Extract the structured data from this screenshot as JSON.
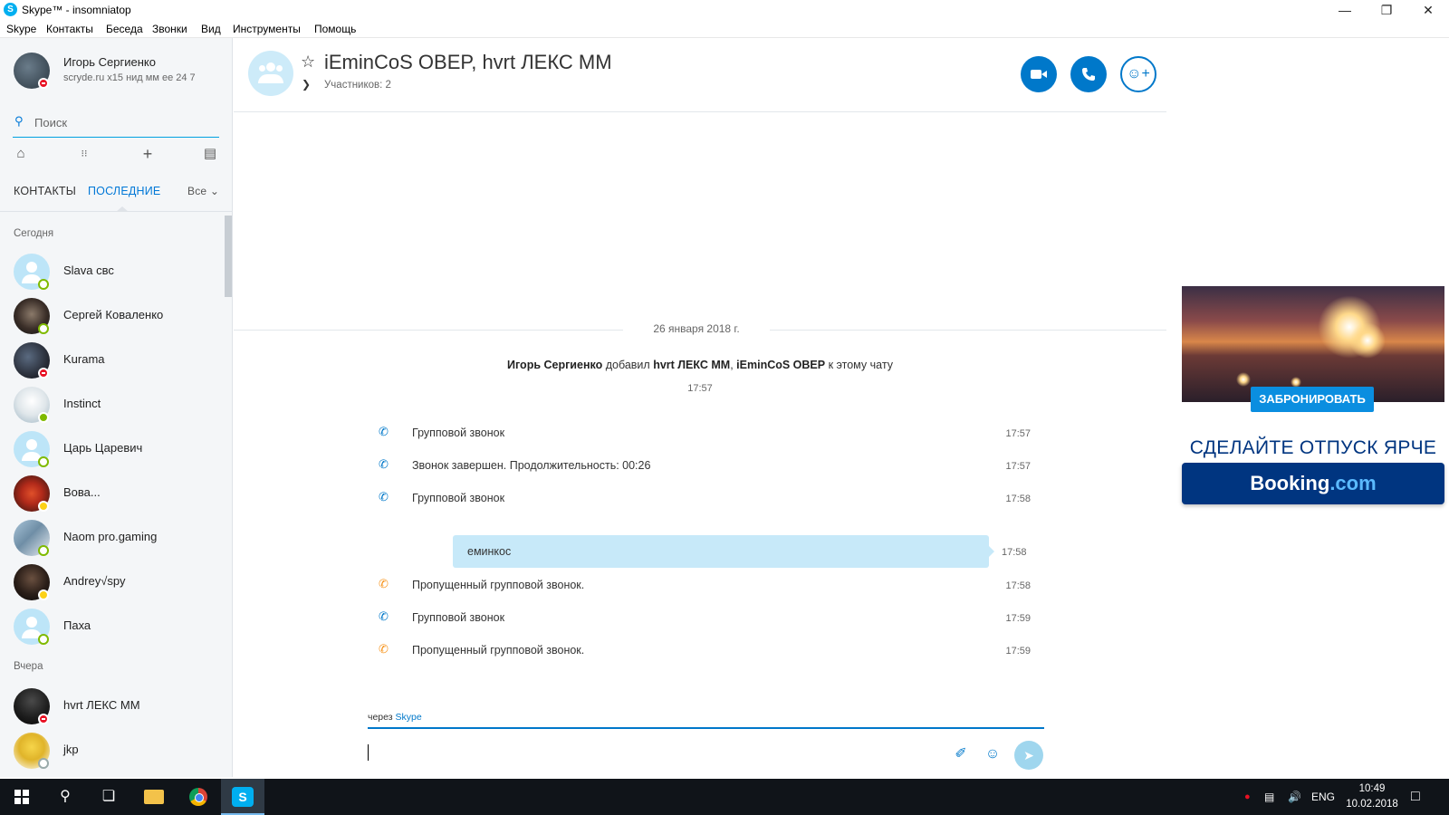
{
  "window": {
    "title": "Skype™ - insomniatop",
    "icon": "skype-icon"
  },
  "menu": [
    "Skype",
    "Контакты",
    "Беседа",
    "Звонки",
    "Вид",
    "Инструменты",
    "Помощь"
  ],
  "profile": {
    "name": "Игорь Сергиенко",
    "mood": "scryde.ru x15 нид мм ее 24 7",
    "status": "do-not-disturb"
  },
  "search": {
    "placeholder": "Поиск"
  },
  "tabs": {
    "contacts": "КОНТАКТЫ",
    "recent": "ПОСЛЕДНИЕ",
    "filter": "Все"
  },
  "groups": {
    "today": "Сегодня",
    "yesterday": "Вчера"
  },
  "contacts_today": [
    {
      "name": "Slava свс",
      "status": "online"
    },
    {
      "name": "Сергей Коваленко",
      "status": "online"
    },
    {
      "name": "Kurama",
      "status": "do-not-disturb"
    },
    {
      "name": "Instinct",
      "status": "online"
    },
    {
      "name": "Царь Царевич",
      "status": "online"
    },
    {
      "name": "Вова...",
      "status": "away"
    },
    {
      "name": "Naom pro.gaming",
      "status": "online"
    },
    {
      "name": "Andrey√spy",
      "status": "away"
    },
    {
      "name": "Паха",
      "status": "online"
    }
  ],
  "contacts_yesterday": [
    {
      "name": "hvrt ЛЕКС MM",
      "status": "do-not-disturb"
    },
    {
      "name": "jkp",
      "status": "offline"
    }
  ],
  "conversation": {
    "title": "iEminCoS OBEP, hvrt ЛЕКС MM",
    "participants": "Участников: 2",
    "date_separator": "26 января 2018 г.",
    "system": {
      "actor": "Игорь Сергиенко",
      "verb": "добавил",
      "user1": "hvrt ЛЕКС MM",
      "sep": ",",
      "user2": "iEminCoS OBEP",
      "rest": "к этому чату",
      "time": "17:57"
    },
    "events": [
      {
        "icon": "incoming-call-icon",
        "color": "#0078ca",
        "text": "Групповой звонок",
        "time": "17:57"
      },
      {
        "icon": "call-ended-icon",
        "color": "#0078ca",
        "text": "Звонок завершен. Продолжительность: 00:26",
        "time": "17:57"
      },
      {
        "icon": "incoming-call-icon",
        "color": "#0078ca",
        "text": "Групповой звонок",
        "time": "17:58"
      }
    ],
    "bubble": {
      "text": "еминкос",
      "time": "17:58"
    },
    "events_after": [
      {
        "icon": "missed-call-icon",
        "color": "#f7941d",
        "text": "Пропущенный групповой звонок.",
        "time": "17:58"
      },
      {
        "icon": "incoming-call-icon",
        "color": "#0078ca",
        "text": "Групповой звонок",
        "time": "17:59"
      },
      {
        "icon": "missed-call-icon",
        "color": "#f7941d",
        "text": "Пропущенный групповой звонок.",
        "time": "17:59"
      }
    ],
    "via_prefix": "через",
    "via_link": "Skype"
  },
  "ad": {
    "button": "ЗАБРОНИРОВАТЬ",
    "headline": "СДЕЛАЙТЕ ОТПУСК ЯРЧЕ",
    "logo_main": "Booking",
    "logo_suffix": ".com"
  },
  "taskbar": {
    "lang": "ENG",
    "time": "10:49",
    "date": "10.02.2018"
  },
  "colors": {
    "accent": "#0078ca",
    "bubble": "#c7e9f9",
    "missed": "#f7941d",
    "online": "#7fba00",
    "dnd": "#e81123",
    "away": "#fcd116"
  }
}
